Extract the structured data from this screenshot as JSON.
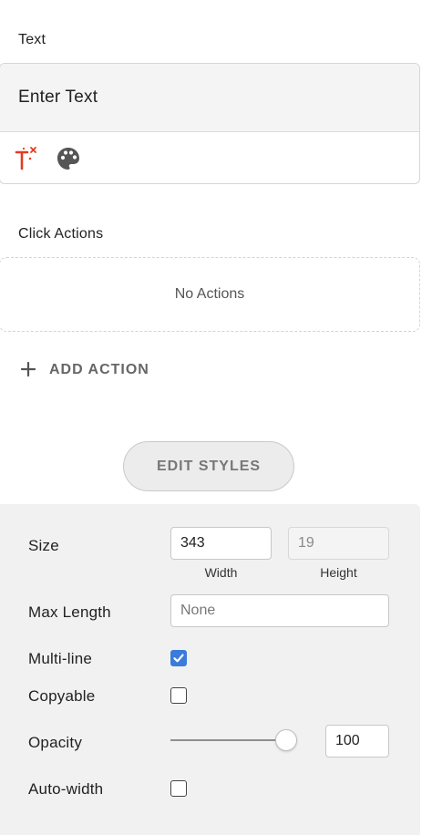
{
  "text_section": {
    "label": "Text",
    "input_value": "Enter Text",
    "tools": [
      {
        "icon": "text-effects-icon",
        "color": "#e53b1f"
      },
      {
        "icon": "palette-icon",
        "color": "#555555"
      }
    ]
  },
  "click_actions": {
    "label": "Click Actions",
    "empty_text": "No Actions",
    "add_label": "ADD ACTION",
    "add_icon": "plus-icon"
  },
  "edit_styles": {
    "label": "EDIT STYLES"
  },
  "styles": {
    "size": {
      "label": "Size",
      "width_value": "343",
      "width_caption": "Width",
      "height_value": "19",
      "height_caption": "Height"
    },
    "max_length": {
      "label": "Max Length",
      "placeholder": "None"
    },
    "multi_line": {
      "label": "Multi-line",
      "checked": true
    },
    "copyable": {
      "label": "Copyable",
      "checked": false
    },
    "opacity": {
      "label": "Opacity",
      "value": "100",
      "slider_fraction": 1.0
    },
    "auto_width": {
      "label": "Auto-width",
      "checked": false
    }
  },
  "colors": {
    "checkbox_checked": "#3a7bdc",
    "panel_background": "#f1f1f1"
  }
}
